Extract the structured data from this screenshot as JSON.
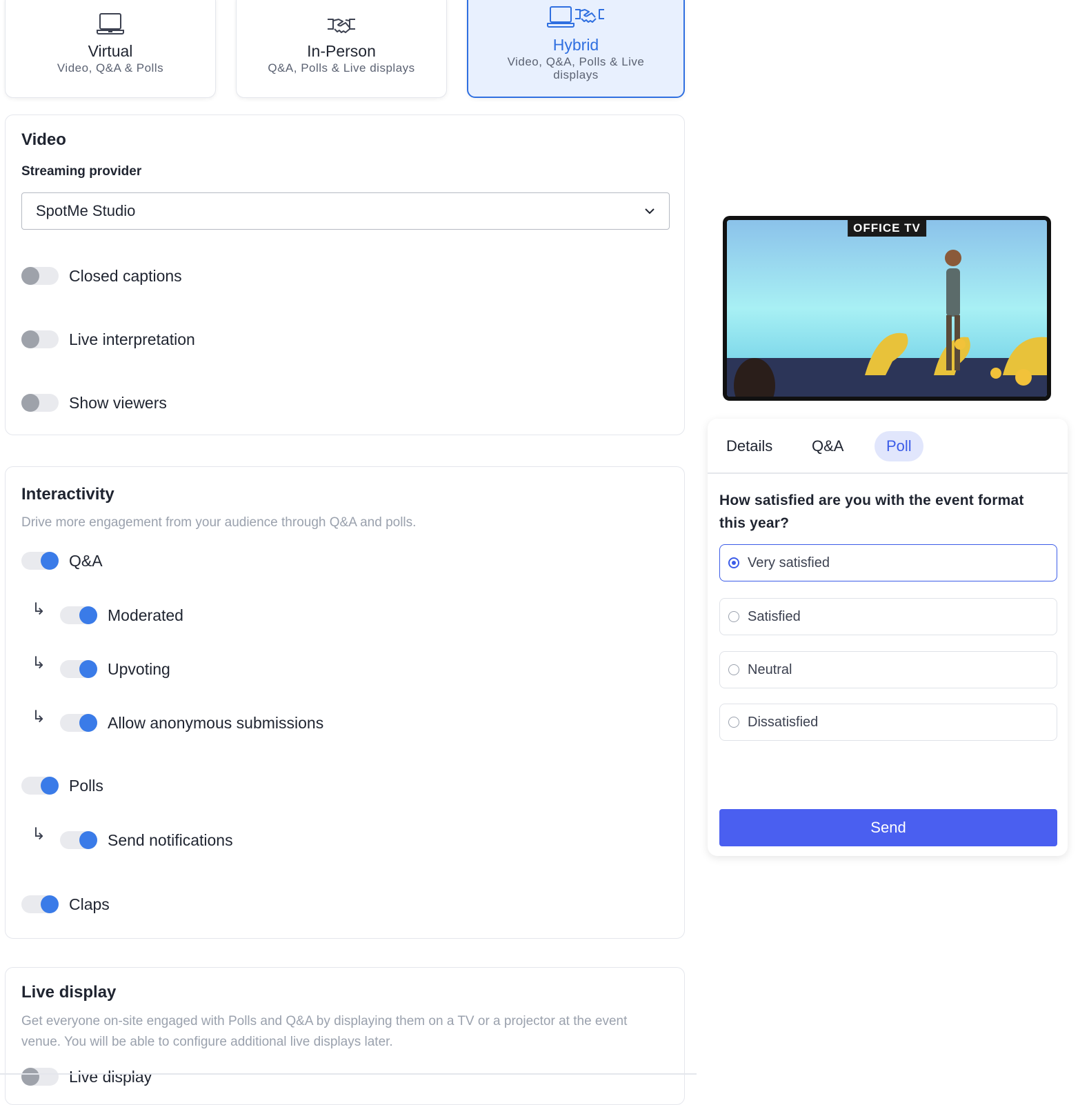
{
  "formats": [
    {
      "title": "Virtual",
      "subtitle": "Video, Q&A & Polls",
      "icon": "laptop-icon",
      "selected": false
    },
    {
      "title": "In-Person",
      "subtitle": "Q&A, Polls & Live displays",
      "icon": "handshake-icon",
      "selected": false
    },
    {
      "title": "Hybrid",
      "subtitle": "Video, Q&A, Polls & Live displays",
      "icon": "laptop-handshake-icon",
      "selected": true
    }
  ],
  "video": {
    "title": "Video",
    "provider_label": "Streaming provider",
    "provider_value": "SpotMe Studio",
    "toggles": [
      {
        "label": "Closed captions",
        "on": false
      },
      {
        "label": "Live interpretation",
        "on": false
      },
      {
        "label": "Show viewers",
        "on": false
      }
    ]
  },
  "interactivity": {
    "title": "Interactivity",
    "description": "Drive more engagement from your audience through Q&A and polls.",
    "qa": "Q&A",
    "moderated": "Moderated",
    "upvoting": "Upvoting",
    "anonymous": "Allow anonymous submissions",
    "polls": "Polls",
    "notifications": "Send notifications",
    "claps": "Claps"
  },
  "live_display": {
    "title": "Live display",
    "description": "Get everyone on-site engaged with Polls and Q&A by displaying them on a TV or a projector at the event venue. You will be able to configure additional live displays later.",
    "toggle_label": "Live display"
  },
  "preview": {
    "tv_label": "OFFICE TV",
    "tabs": [
      "Details",
      "Q&A",
      "Poll"
    ],
    "active_tab": "Poll",
    "question": "How satisfied are you with the event format this year?",
    "options": [
      "Very satisfied",
      "Satisfied",
      "Neutral",
      "Dissatisfied"
    ],
    "selected_option": "Very satisfied",
    "send_label": "Send"
  },
  "colors": {
    "accent": "#2f6fe0",
    "toggle_on": "#3a7be8",
    "send_button": "#4a5ff0"
  }
}
